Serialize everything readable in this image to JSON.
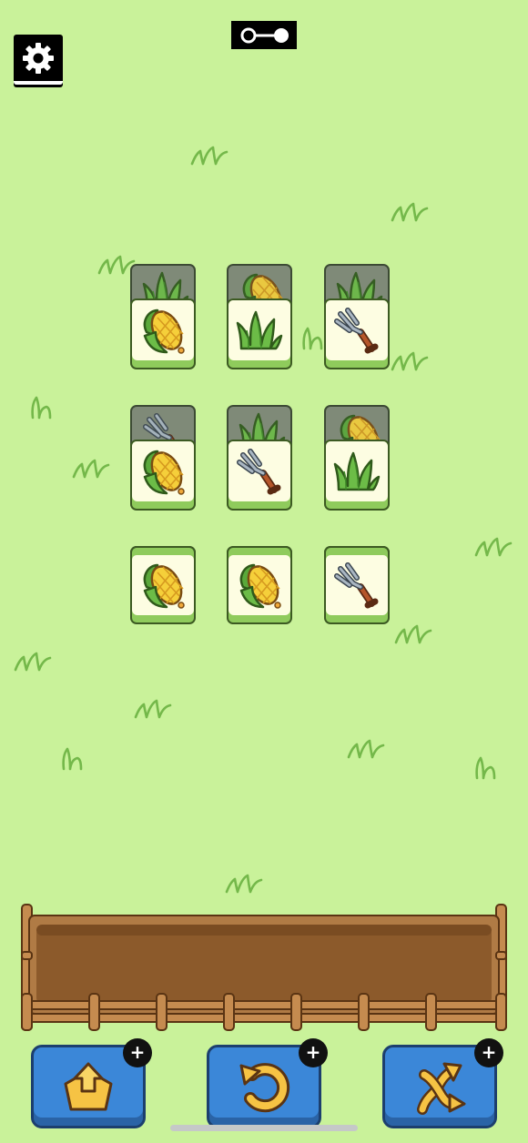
{
  "top_bar": {
    "settings_icon": "gear-icon",
    "center_icon": "key-slider-icon"
  },
  "board": {
    "rows": [
      [
        {
          "top": "corn",
          "under": "grass"
        },
        {
          "top": "grass",
          "under": "corn"
        },
        {
          "top": "pitchfork",
          "under": "grass"
        }
      ],
      [
        {
          "top": "corn",
          "under": "pitchfork"
        },
        {
          "top": "pitchfork",
          "under": "grass"
        },
        {
          "top": "grass",
          "under": "corn"
        }
      ],
      [
        {
          "top": "corn",
          "under": null
        },
        {
          "top": "corn",
          "under": null
        },
        {
          "top": "pitchfork",
          "under": null
        }
      ]
    ]
  },
  "tray": {
    "slots_filled": 0
  },
  "actions": [
    {
      "name": "return-tiles",
      "icon": "box-up-arrow-icon",
      "badge": "+"
    },
    {
      "name": "undo",
      "icon": "undo-icon",
      "badge": "+"
    },
    {
      "name": "shuffle",
      "icon": "shuffle-icon",
      "badge": "+"
    }
  ],
  "colors": {
    "background": "#c9f29a",
    "tile_face": "#fdfde2",
    "button_blue": "#3b87d8",
    "fence_wood": "#b07b45",
    "tray_soil": "#8c5a2b"
  }
}
